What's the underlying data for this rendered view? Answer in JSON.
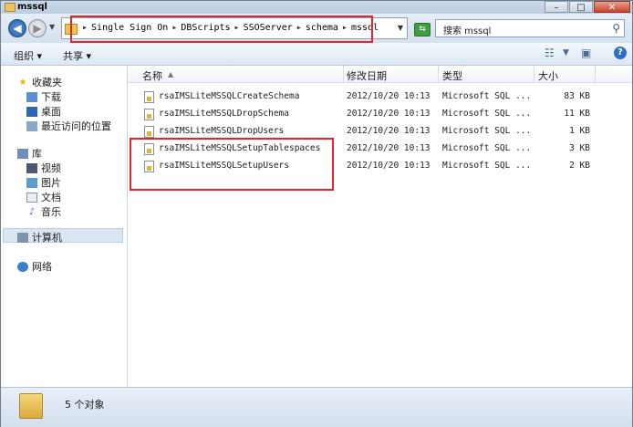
{
  "window": {
    "title": "mssql"
  },
  "address": {
    "crumbs": [
      "Single Sign On",
      "DBScripts",
      "SSOServer",
      "schema",
      "mssql"
    ],
    "search_placeholder": "搜索 mssql"
  },
  "toolbar": {
    "organize": "组织 ▾",
    "share": "共享 ▾"
  },
  "nav": {
    "favorites": "收藏夹",
    "downloads": "下载",
    "desktop": "桌面",
    "recent": "最近访问的位置",
    "library": "库",
    "videos": "视频",
    "pictures": "图片",
    "documents": "文档",
    "music": "音乐",
    "computer": "计算机",
    "network": "网络"
  },
  "columns": {
    "name": "名称",
    "modified": "修改日期",
    "type": "类型",
    "size": "大小"
  },
  "files": [
    {
      "name": "rsaIMSLiteMSSQLCreateSchema",
      "modified": "2012/10/20 10:13",
      "type": "Microsoft SQL ...",
      "size": "83 KB"
    },
    {
      "name": "rsaIMSLiteMSSQLDropSchema",
      "modified": "2012/10/20 10:13",
      "type": "Microsoft SQL ...",
      "size": "11 KB"
    },
    {
      "name": "rsaIMSLiteMSSQLDropUsers",
      "modified": "2012/10/20 10:13",
      "type": "Microsoft SQL ...",
      "size": "1 KB"
    },
    {
      "name": "rsaIMSLiteMSSQLSetupTablespaces",
      "modified": "2012/10/20 10:13",
      "type": "Microsoft SQL ...",
      "size": "3 KB"
    },
    {
      "name": "rsaIMSLiteMSSQLSetupUsers",
      "modified": "2012/10/20 10:13",
      "type": "Microsoft SQL ...",
      "size": "2 KB"
    }
  ],
  "status": {
    "count": "5 个对象"
  },
  "colors": {
    "highlight": "#e8242b",
    "selection": "#dbe6f3"
  }
}
